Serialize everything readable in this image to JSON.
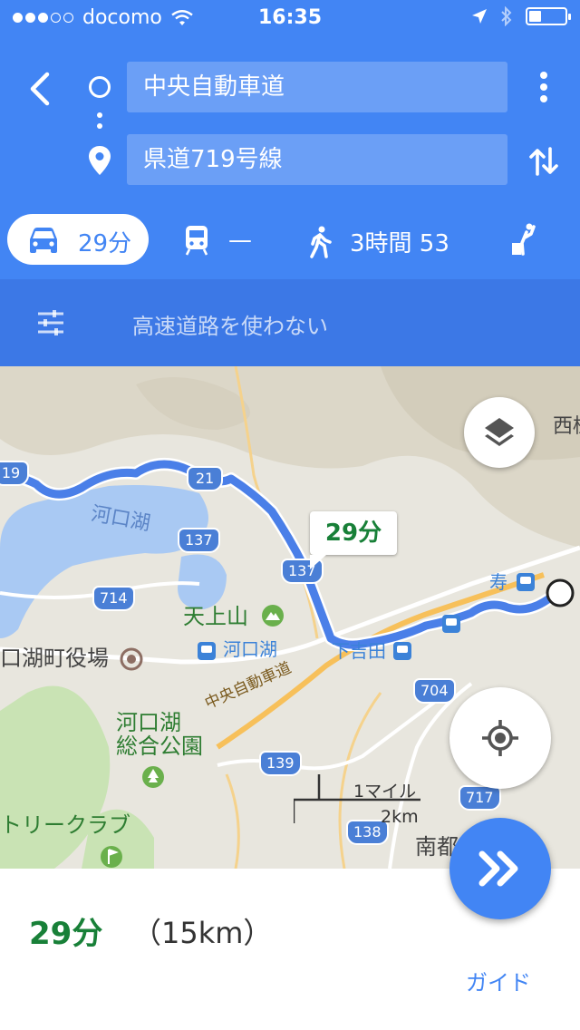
{
  "status_bar": {
    "carrier": "docomo",
    "time": "16:35",
    "signal_bars_filled": 3,
    "signal_bars_total": 5,
    "battery_level": 0.35
  },
  "directions": {
    "origin": "中央自動車道",
    "destination": "県道719号線"
  },
  "modes": {
    "car_time": "29分",
    "transit_time": "—",
    "walk_time": "3時間 53"
  },
  "options": {
    "label": "高速道路を使わない"
  },
  "map": {
    "route_time_callout": "29分",
    "places": {
      "lake": "河口湖",
      "mountain": "天上山",
      "station_kawaguchiko": "河口湖",
      "station_shimoyoshida": "下吉田",
      "station_kotobuki": "寿",
      "town_hall": "口湖町役場",
      "park": "河口湖\n総合公園",
      "expressway": "中央自動車道",
      "club": "トリークラブ",
      "city_south": "南都",
      "city_west": "西桂"
    },
    "shields": [
      "19",
      "21",
      "137",
      "137",
      "714",
      "704",
      "139",
      "717",
      "138"
    ],
    "scale": {
      "imperial": "1マイル",
      "metric": "2km"
    }
  },
  "summary": {
    "time": "29分",
    "distance": "（15km）",
    "guide_label": "ガイド"
  },
  "colors": {
    "primary": "#4285f4",
    "route": "#4a7fe8",
    "time_green": "#188038"
  },
  "icons": [
    "back-icon",
    "origin-circle-icon",
    "destination-pin-icon",
    "more-vert-icon",
    "swap-icon",
    "car-icon",
    "train-icon",
    "walk-icon",
    "ride-icon",
    "tune-icon",
    "layers-icon",
    "my-location-icon",
    "navigation-icon"
  ]
}
